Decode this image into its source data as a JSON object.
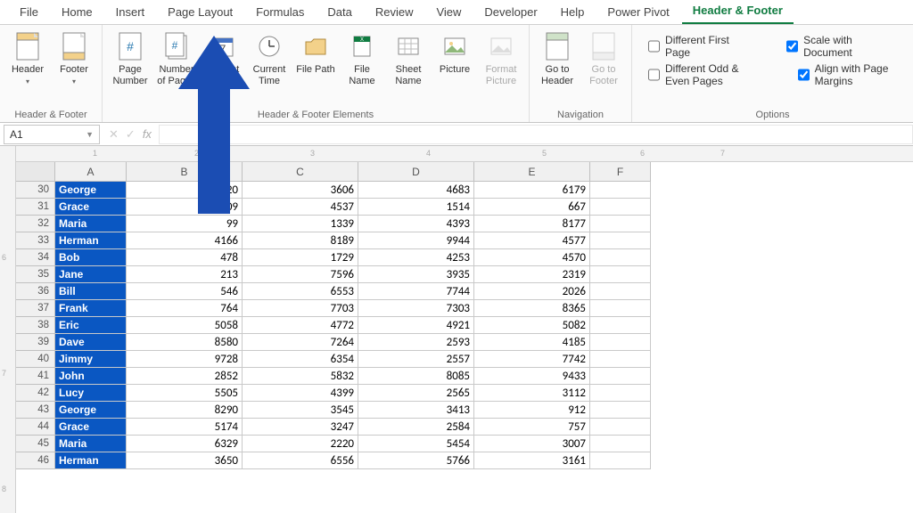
{
  "tabs": [
    "File",
    "Home",
    "Insert",
    "Page Layout",
    "Formulas",
    "Data",
    "Review",
    "View",
    "Developer",
    "Help",
    "Power Pivot",
    "Header & Footer"
  ],
  "active_tab_index": 11,
  "ribbon": {
    "group_hf": {
      "label": "Header & Footer",
      "header": "Header",
      "footer": "Footer"
    },
    "group_elements": {
      "label": "Header & Footer Elements",
      "page_number": "Page Number",
      "number_of_pages": "Number of Pages",
      "current_date": "Current Date",
      "current_time": "Current Time",
      "file_path": "File Path",
      "file_name": "File Name",
      "sheet_name": "Sheet Name",
      "picture": "Picture",
      "format_picture": "Format Picture"
    },
    "group_nav": {
      "label": "Navigation",
      "goto_header": "Go to Header",
      "goto_footer": "Go to Footer"
    },
    "group_options": {
      "label": "Options",
      "diff_first": "Different First Page",
      "diff_odd_even": "Different Odd & Even Pages",
      "scale": "Scale with Document",
      "align": "Align with Page Margins",
      "diff_first_checked": false,
      "diff_odd_even_checked": false,
      "scale_checked": true,
      "align_checked": true
    }
  },
  "namebox": "A1",
  "columns": [
    "A",
    "B",
    "C",
    "D",
    "E",
    "F"
  ],
  "ruler_top": [
    "1",
    "2",
    "3",
    "4",
    "5",
    "6",
    "7"
  ],
  "rows": [
    {
      "n": 30,
      "name": "George",
      "v": [
        5520,
        3606,
        4683,
        6179
      ]
    },
    {
      "n": 31,
      "name": "Grace",
      "v": [
        4509,
        4537,
        1514,
        667
      ]
    },
    {
      "n": 32,
      "name": "Maria",
      "v": [
        99,
        1339,
        4393,
        8177
      ]
    },
    {
      "n": 33,
      "name": "Herman",
      "v": [
        4166,
        8189,
        9944,
        4577
      ]
    },
    {
      "n": 34,
      "name": "Bob",
      "v": [
        478,
        1729,
        4253,
        4570
      ]
    },
    {
      "n": 35,
      "name": "Jane",
      "v": [
        213,
        7596,
        3935,
        2319
      ]
    },
    {
      "n": 36,
      "name": "Bill",
      "v": [
        546,
        6553,
        7744,
        2026
      ]
    },
    {
      "n": 37,
      "name": "Frank",
      "v": [
        764,
        7703,
        7303,
        8365
      ]
    },
    {
      "n": 38,
      "name": "Eric",
      "v": [
        5058,
        4772,
        4921,
        5082
      ]
    },
    {
      "n": 39,
      "name": "Dave",
      "v": [
        8580,
        7264,
        2593,
        4185
      ]
    },
    {
      "n": 40,
      "name": "Jimmy",
      "v": [
        9728,
        6354,
        2557,
        7742
      ]
    },
    {
      "n": 41,
      "name": "John",
      "v": [
        2852,
        5832,
        8085,
        9433
      ]
    },
    {
      "n": 42,
      "name": "Lucy",
      "v": [
        5505,
        4399,
        2565,
        3112
      ]
    },
    {
      "n": 43,
      "name": "George",
      "v": [
        8290,
        3545,
        3413,
        912
      ]
    },
    {
      "n": 44,
      "name": "Grace",
      "v": [
        5174,
        3247,
        2584,
        757
      ]
    },
    {
      "n": 45,
      "name": "Maria",
      "v": [
        6329,
        2220,
        5454,
        3007
      ]
    },
    {
      "n": 46,
      "name": "Herman",
      "v": [
        3650,
        6556,
        5766,
        3161
      ]
    }
  ]
}
